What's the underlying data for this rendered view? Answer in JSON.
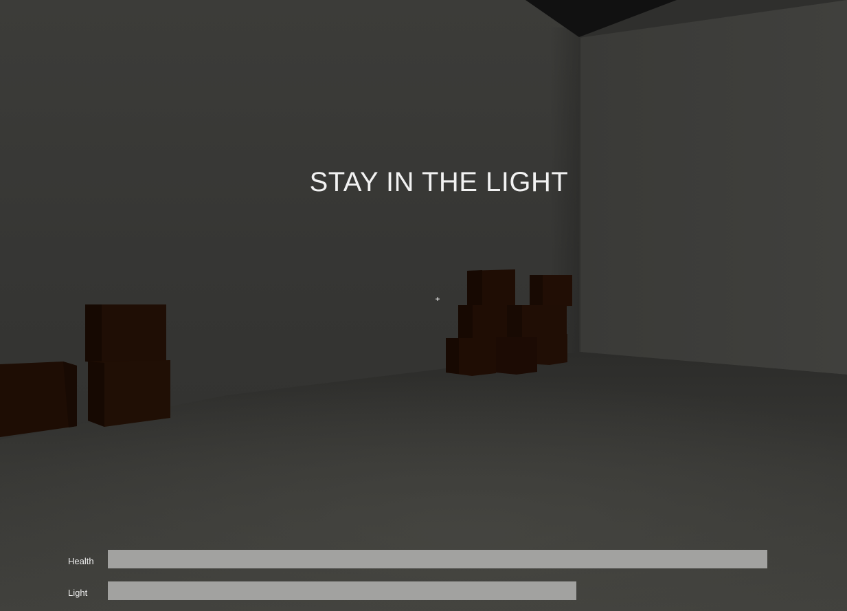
{
  "hud": {
    "message": "STAY IN THE LIGHT",
    "crosshair": "+",
    "health": {
      "label": "Health",
      "value_fraction": 1.0
    },
    "light": {
      "label": "Light",
      "value_fraction": 0.71
    }
  },
  "colors": {
    "bar_fill": "#a2a2a0",
    "text": "#f2f2f2",
    "wall": "#3c3c39",
    "floor": "#40403c",
    "ceiling": "#111111",
    "crate": "#1f0e05"
  }
}
